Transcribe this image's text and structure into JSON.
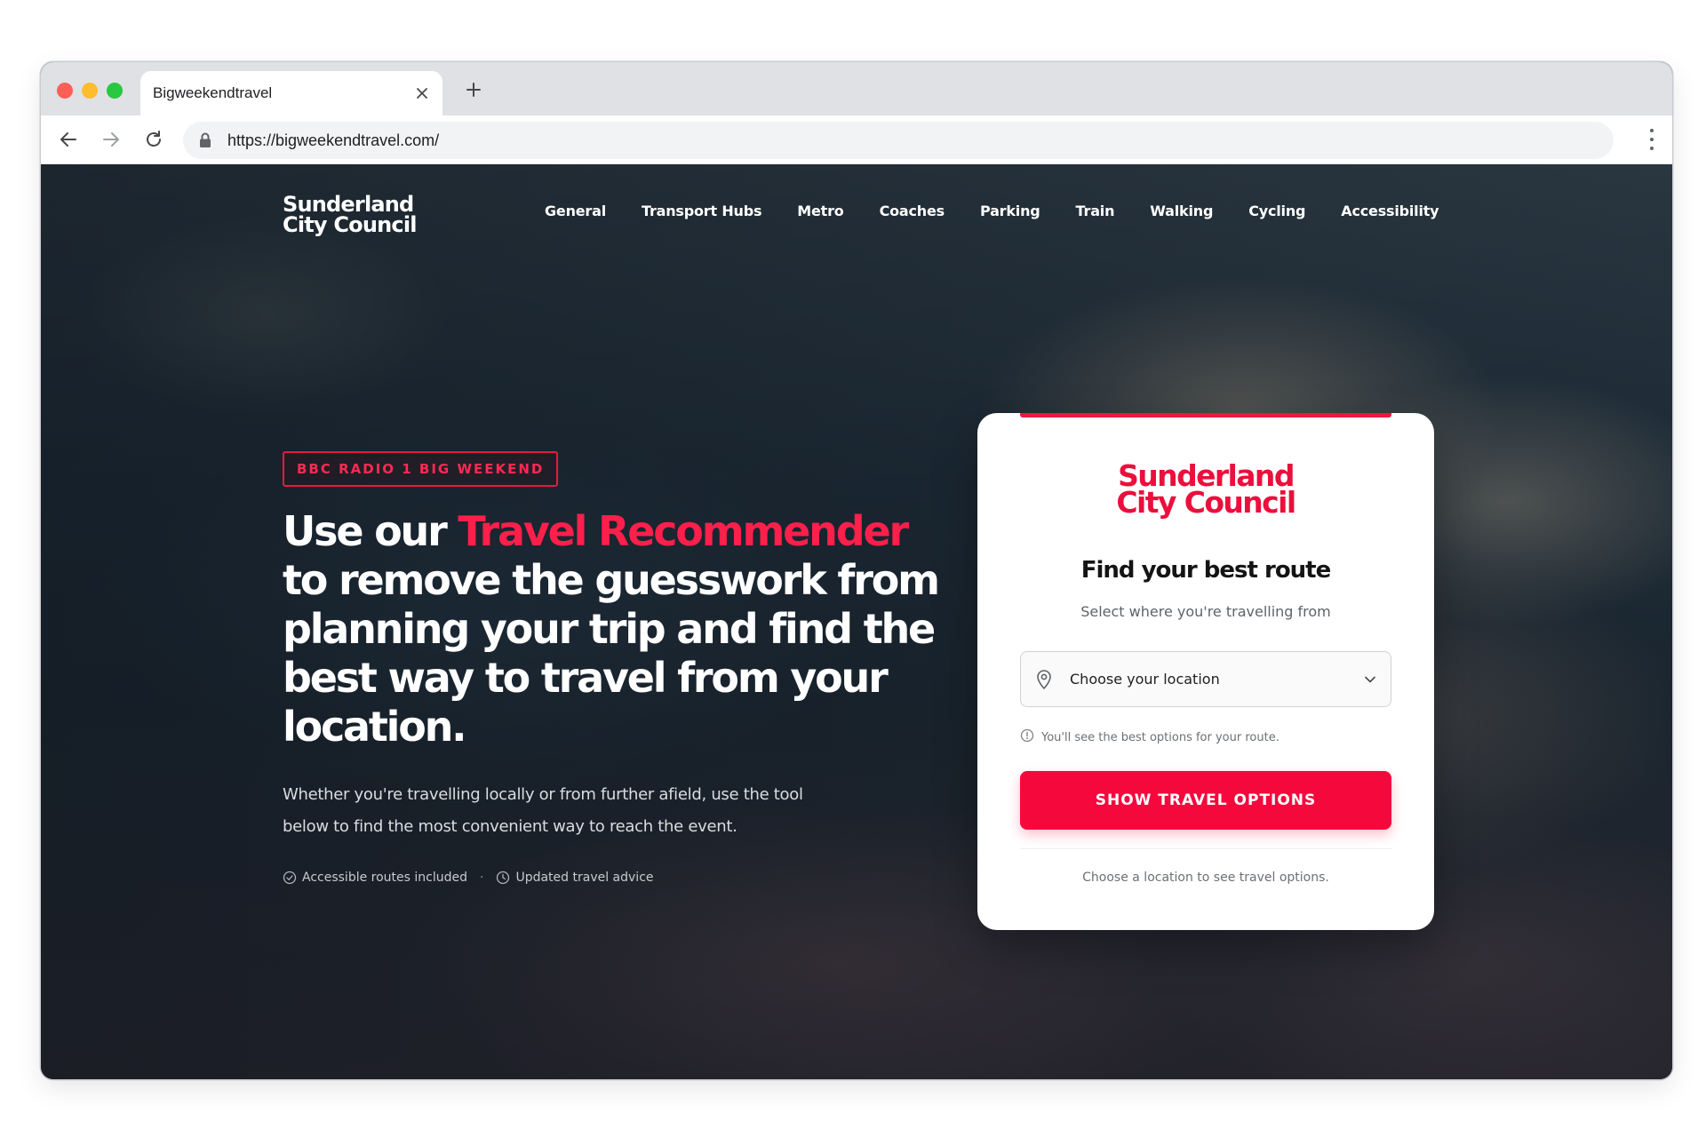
{
  "browser": {
    "tab_title": "Bigweekendtravel",
    "url": "https://bigweekendtravel.com/"
  },
  "brand": {
    "line1": "Sunderland",
    "line2": "City Council"
  },
  "nav": {
    "items": [
      "General",
      "Transport Hubs",
      "Metro",
      "Coaches",
      "Parking",
      "Train",
      "Walking",
      "Cycling",
      "Accessibility"
    ]
  },
  "hero": {
    "badge": "BBC RADIO 1 BIG WEEKEND",
    "headline_prefix": "Use our ",
    "headline_accent": "Travel Recommender",
    "headline_rest": " to remove the guesswork from planning your trip and find the best way to travel from your location.",
    "lead": "Whether you're travelling locally or from further afield, use the tool below to find the most convenient way to reach the event.",
    "features": [
      "Accessible routes included",
      "Updated travel advice"
    ],
    "feature_separator": "·"
  },
  "card": {
    "brand_line1": "Sunderland",
    "brand_line2": "City Council",
    "title": "Find your best route",
    "subtitle": "Select where you're travelling from",
    "select_value": "Choose your location",
    "hint": "You'll see the best options for your route.",
    "cta": "SHOW TRAVEL OPTIONS",
    "footer": "Choose a location to see travel options."
  },
  "colors": {
    "accent": "#f5093d",
    "brand_red": "#ea0f3c",
    "text_dark": "#141414"
  },
  "icons": [
    "close-icon",
    "plus-icon",
    "back-arrow-icon",
    "forward-arrow-icon",
    "reload-icon",
    "lock-icon",
    "kebab-menu-icon",
    "check-circle-icon",
    "clock-icon",
    "location-pin-icon",
    "chevron-down-icon",
    "info-icon"
  ]
}
